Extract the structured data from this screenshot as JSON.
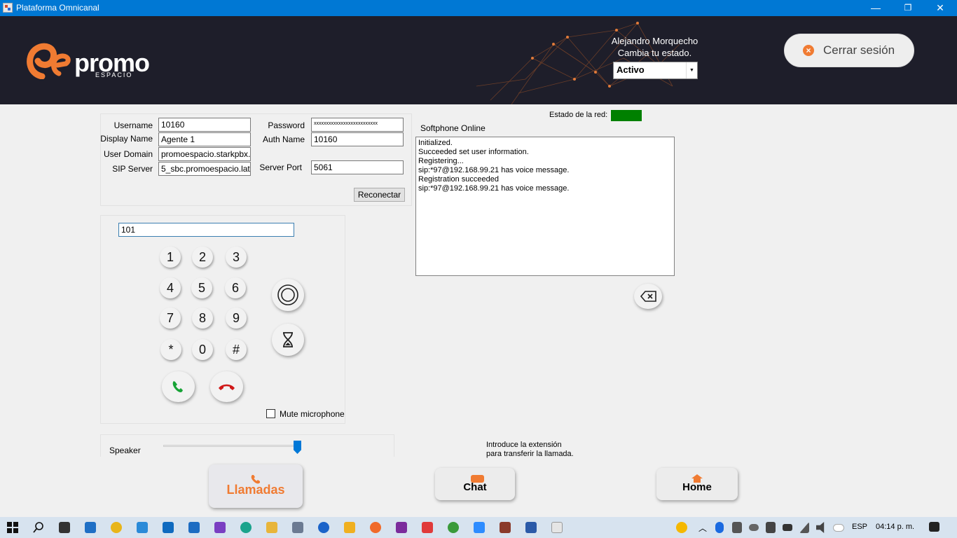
{
  "window": {
    "title": "Plataforma Omnicanal",
    "minimize": "—",
    "restore": "❐",
    "close": "✕"
  },
  "header": {
    "logo_text": "promo",
    "logo_sub": "ESPACIO",
    "user_name": "Alejandro Morquecho",
    "status_label": "Cambia tu estado.",
    "status_value": "Activo",
    "logout_label": "Cerrar sesión"
  },
  "network": {
    "label": "Estado de la red:",
    "status_color": "#008000"
  },
  "sip": {
    "username_label": "Username",
    "username": "10160",
    "password_label": "Password",
    "password": "xxxxxxxxxxxxxxxxxxxxxxxxxx",
    "display_label": "Display Name",
    "display": "Agente 1",
    "auth_label": "Auth Name",
    "auth": "10160",
    "domain_label": "User Domain",
    "domain": "promoespacio.starkpbx.com",
    "server_label": "SIP Server",
    "server": "5_sbc.promoespacio.lat",
    "port_label": "Server Port",
    "port": "5061",
    "reconnect_label": "Reconectar"
  },
  "softphone": {
    "status": "Softphone Online",
    "log": [
      "Initialized.",
      "Succeeded set user information.",
      "Registering...",
      "sip:*97@192.168.99.21 has voice message.",
      "Registration succeeded",
      "sip:*97@192.168.99.21 has voice message."
    ]
  },
  "dialer": {
    "number": "101",
    "keys": [
      "1",
      "2",
      "3",
      "4",
      "5",
      "6",
      "7",
      "8",
      "9",
      "*",
      "0",
      "#"
    ],
    "mute_label": "Mute microphone",
    "speaker_label": "Speaker",
    "speaker_level": 1.0
  },
  "transfer_hint": [
    "Introduce la extensión",
    "para transferir la llamada."
  ],
  "nav": {
    "calls": "Llamadas",
    "chat": "Chat",
    "home": "Home"
  },
  "taskbar": {
    "lang": "ESP",
    "time": "04:14 p. m."
  }
}
